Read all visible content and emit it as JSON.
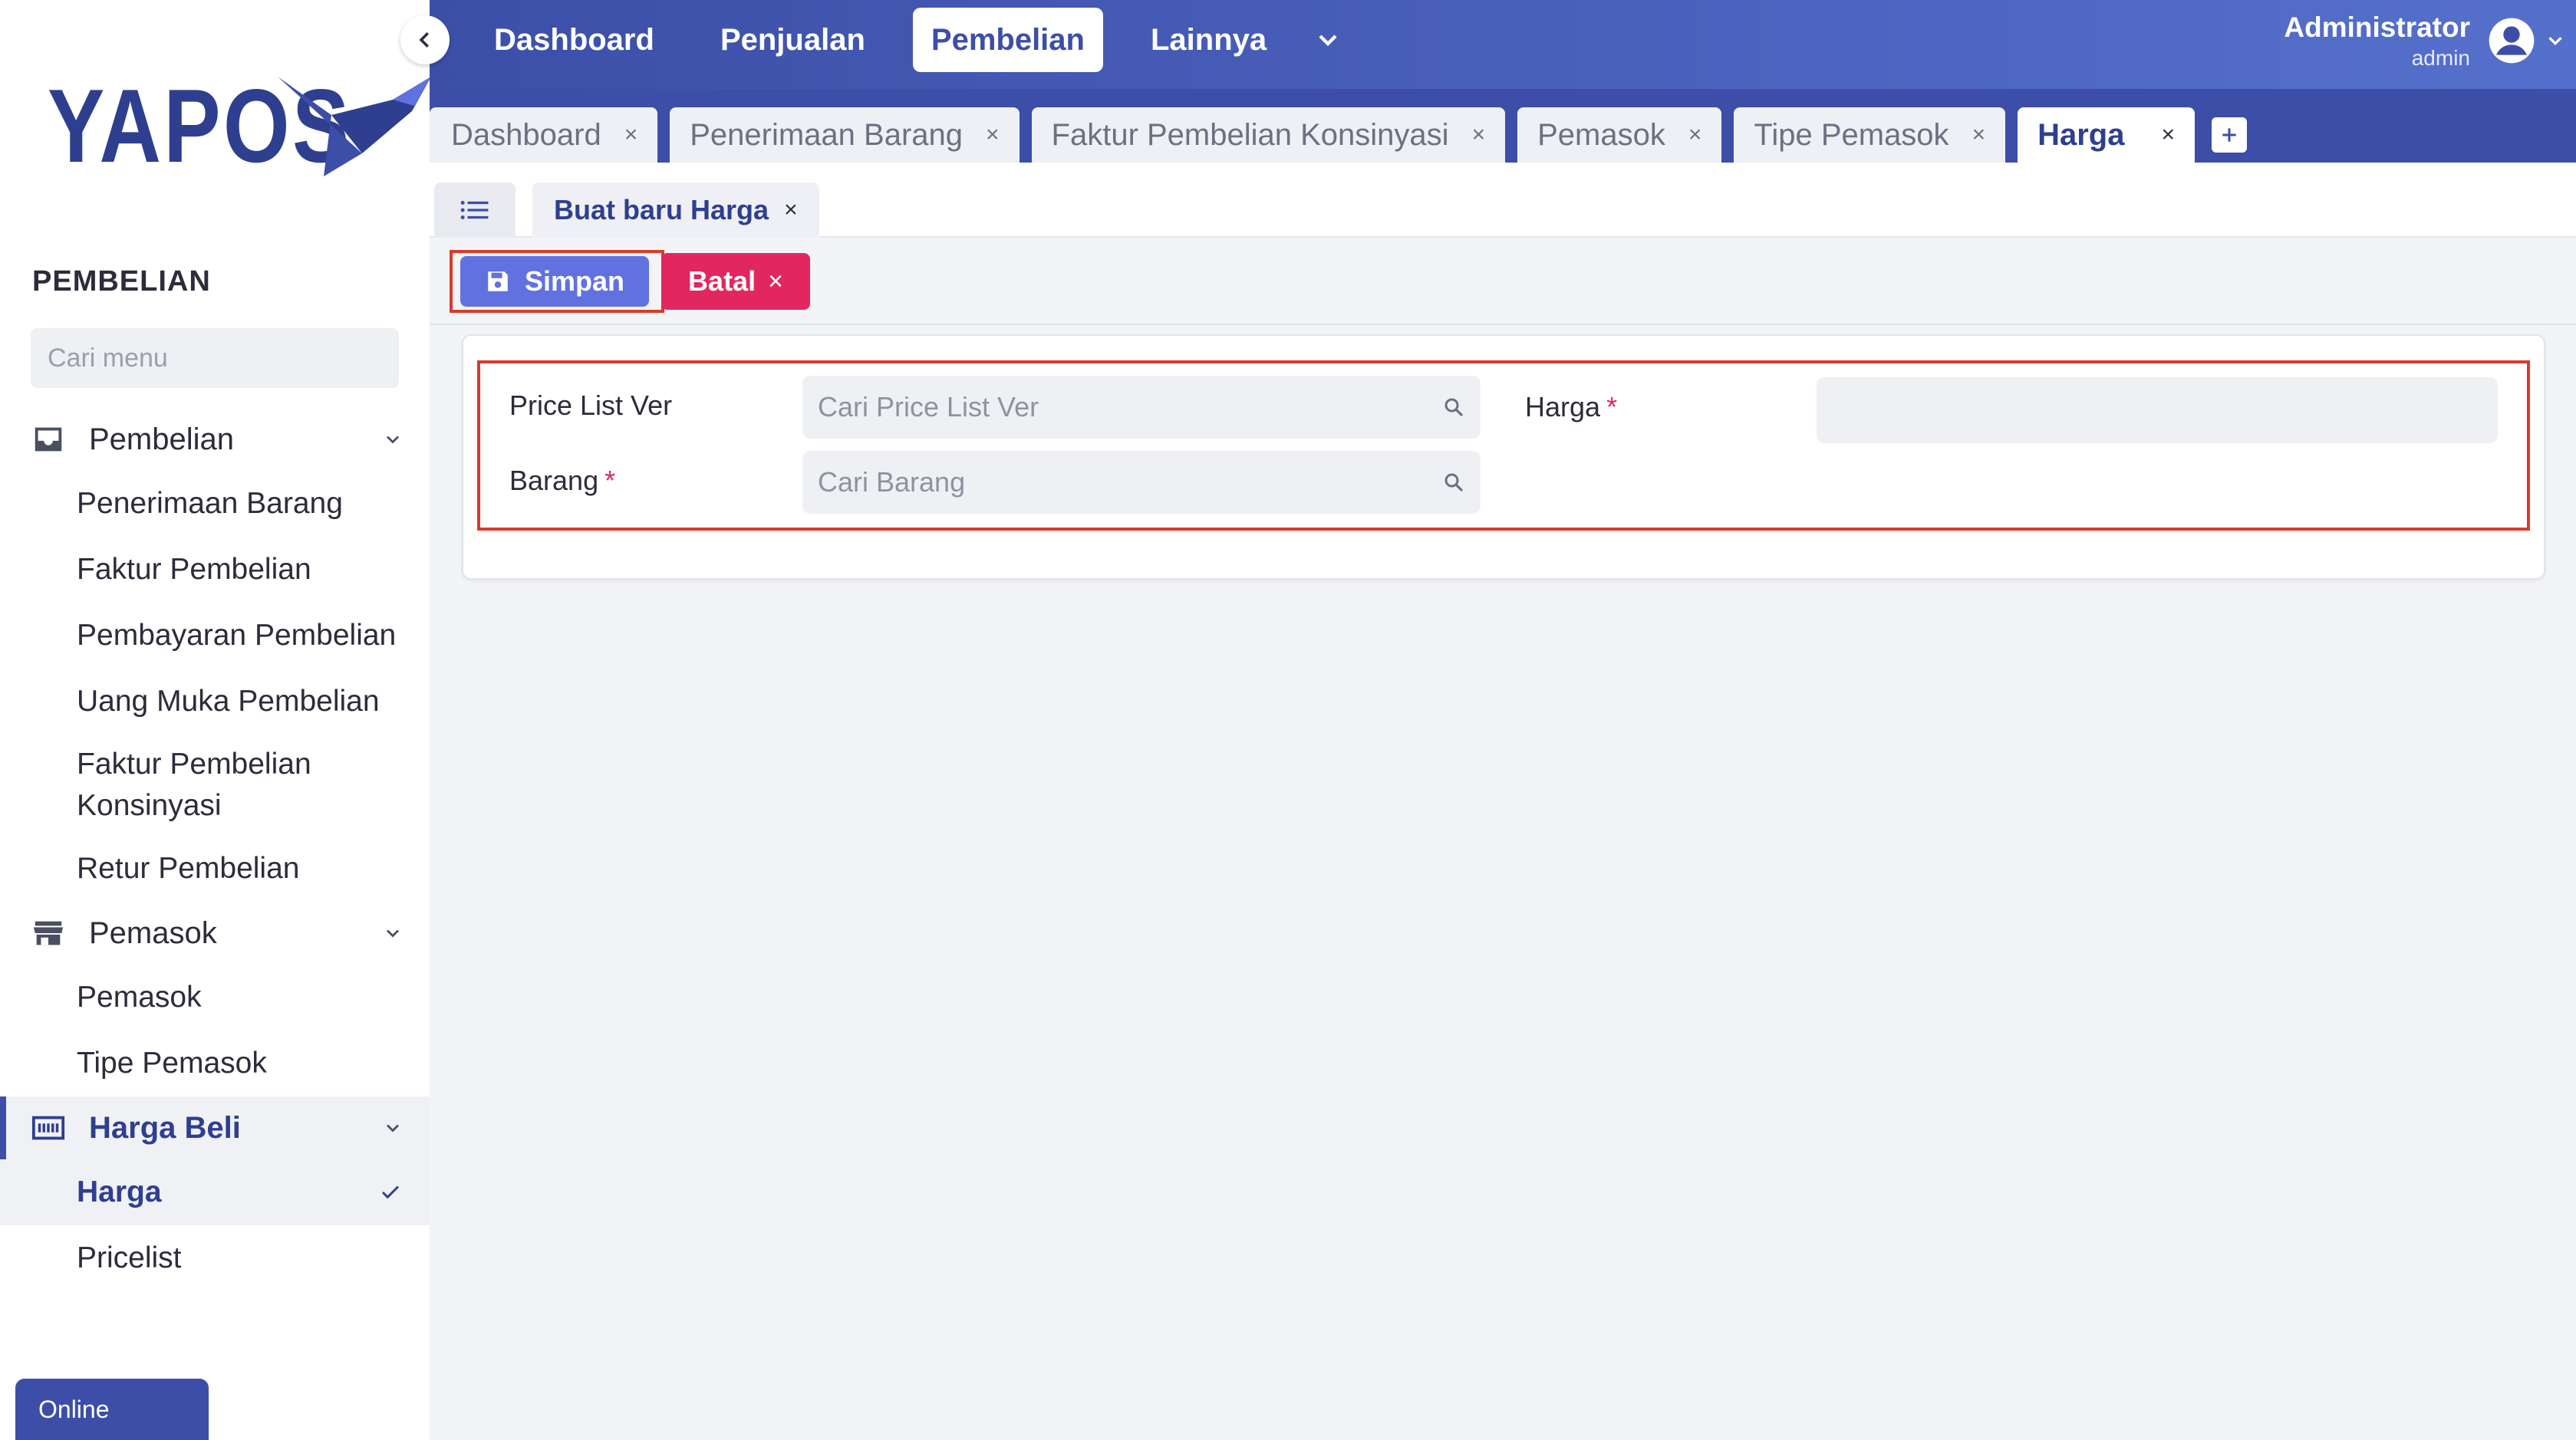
{
  "sidebar": {
    "logo_text": "YAPOS",
    "section_title": "PEMBELIAN",
    "search_placeholder": "Cari menu",
    "groups": [
      {
        "label": "Pembelian",
        "icon": "inbox-tray-icon",
        "items": [
          "Penerimaan Barang",
          "Faktur Pembelian",
          "Pembayaran Pembelian",
          "Uang Muka Pembelian",
          "Faktur Pembelian Konsinyasi",
          "Retur Pembelian"
        ]
      },
      {
        "label": "Pemasok",
        "icon": "store-icon",
        "items": [
          "Pemasok",
          "Tipe Pemasok"
        ]
      },
      {
        "label": "Harga Beli",
        "icon": "price-tag-icon",
        "items": [
          "Harga",
          "Pricelist"
        ],
        "active": true,
        "active_item": "Harga"
      }
    ],
    "status": "Online"
  },
  "topbar": {
    "nav": [
      "Dashboard",
      "Penjualan",
      "Pembelian",
      "Lainnya"
    ],
    "active_nav": "Pembelian",
    "user_name": "Administrator",
    "user_role": "admin"
  },
  "tabs": [
    {
      "label": "Dashboard",
      "close": "×"
    },
    {
      "label": "Penerimaan Barang",
      "close": "×"
    },
    {
      "label": "Faktur Pembelian Konsinyasi",
      "close": "×"
    },
    {
      "label": "Pemasok",
      "close": "×"
    },
    {
      "label": "Tipe Pemasok",
      "close": "×"
    },
    {
      "label": "Harga",
      "close": "×",
      "active": true
    }
  ],
  "subtab": {
    "label": "Buat baru Harga",
    "close": "×"
  },
  "actions": {
    "save_label": "Simpan",
    "cancel_label": "Batal",
    "cancel_icon": "×"
  },
  "form": {
    "price_list_ver": {
      "label": "Price List Ver",
      "placeholder": "Cari Price List Ver",
      "value": ""
    },
    "barang": {
      "label": "Barang",
      "required": "*",
      "placeholder": "Cari Barang",
      "value": ""
    },
    "harga": {
      "label": "Harga",
      "required": "*",
      "value": ""
    }
  },
  "colors": {
    "primary": "#3d4ea8",
    "save_button": "#6172e0",
    "cancel_button": "#e2275f",
    "highlight": "#d93a2b"
  }
}
